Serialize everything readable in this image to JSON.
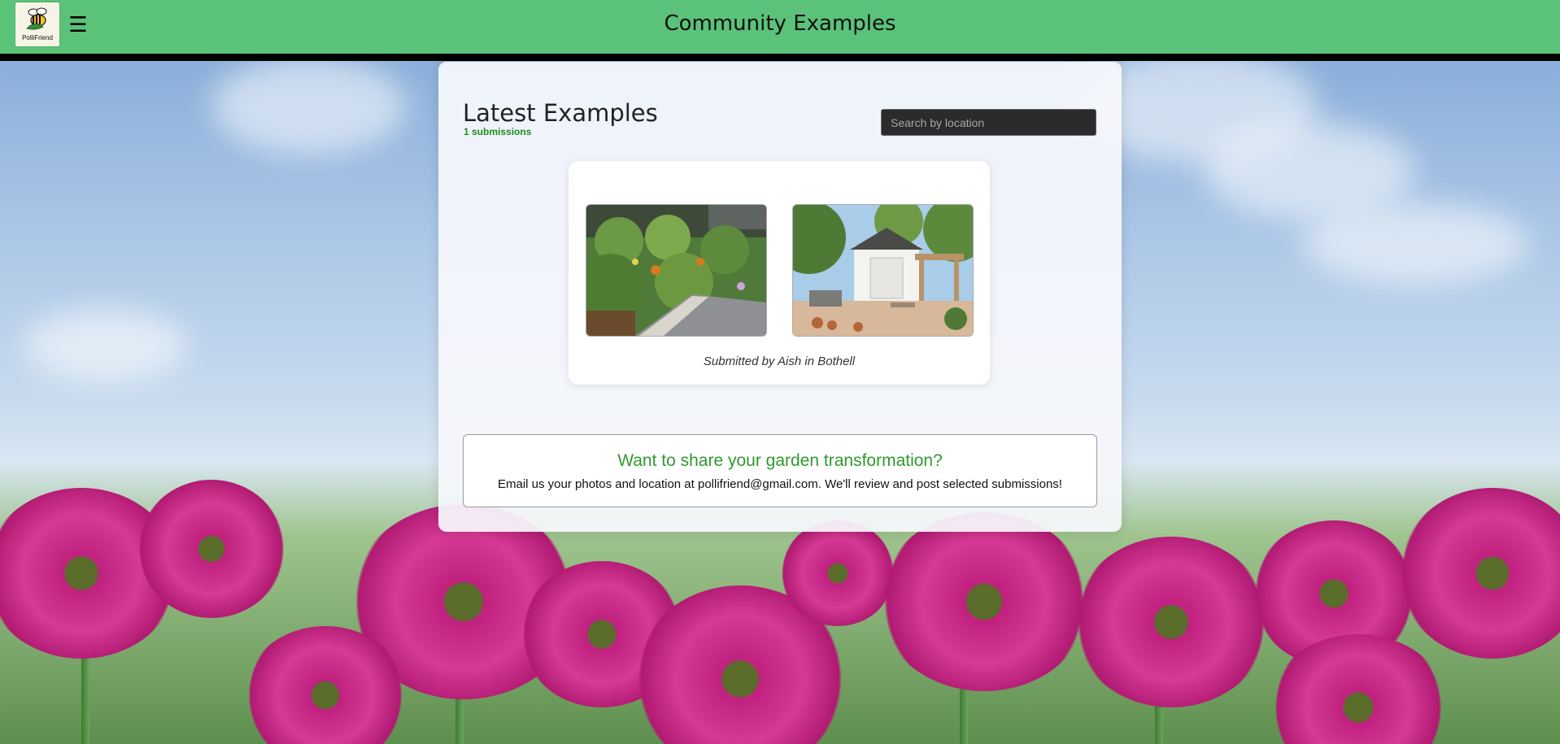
{
  "header": {
    "logo_text": "PolliFriend",
    "menu_icon": "hamburger-menu-icon",
    "title": "Community Examples",
    "brand_color": "#5bc27a"
  },
  "main": {
    "heading": "Latest Examples",
    "submission_count": "1 submissions",
    "search": {
      "placeholder": "Search by location",
      "value": ""
    },
    "submissions": [
      {
        "photos": [
          "garden-before-photo",
          "garden-after-photo"
        ],
        "caption": "Submitted by Aish in Bothell"
      }
    ],
    "share": {
      "title": "Want to share your garden transformation?",
      "text": "Email us your photos and location at pollifriend@gmail.com. We'll review and post selected submissions!"
    }
  }
}
